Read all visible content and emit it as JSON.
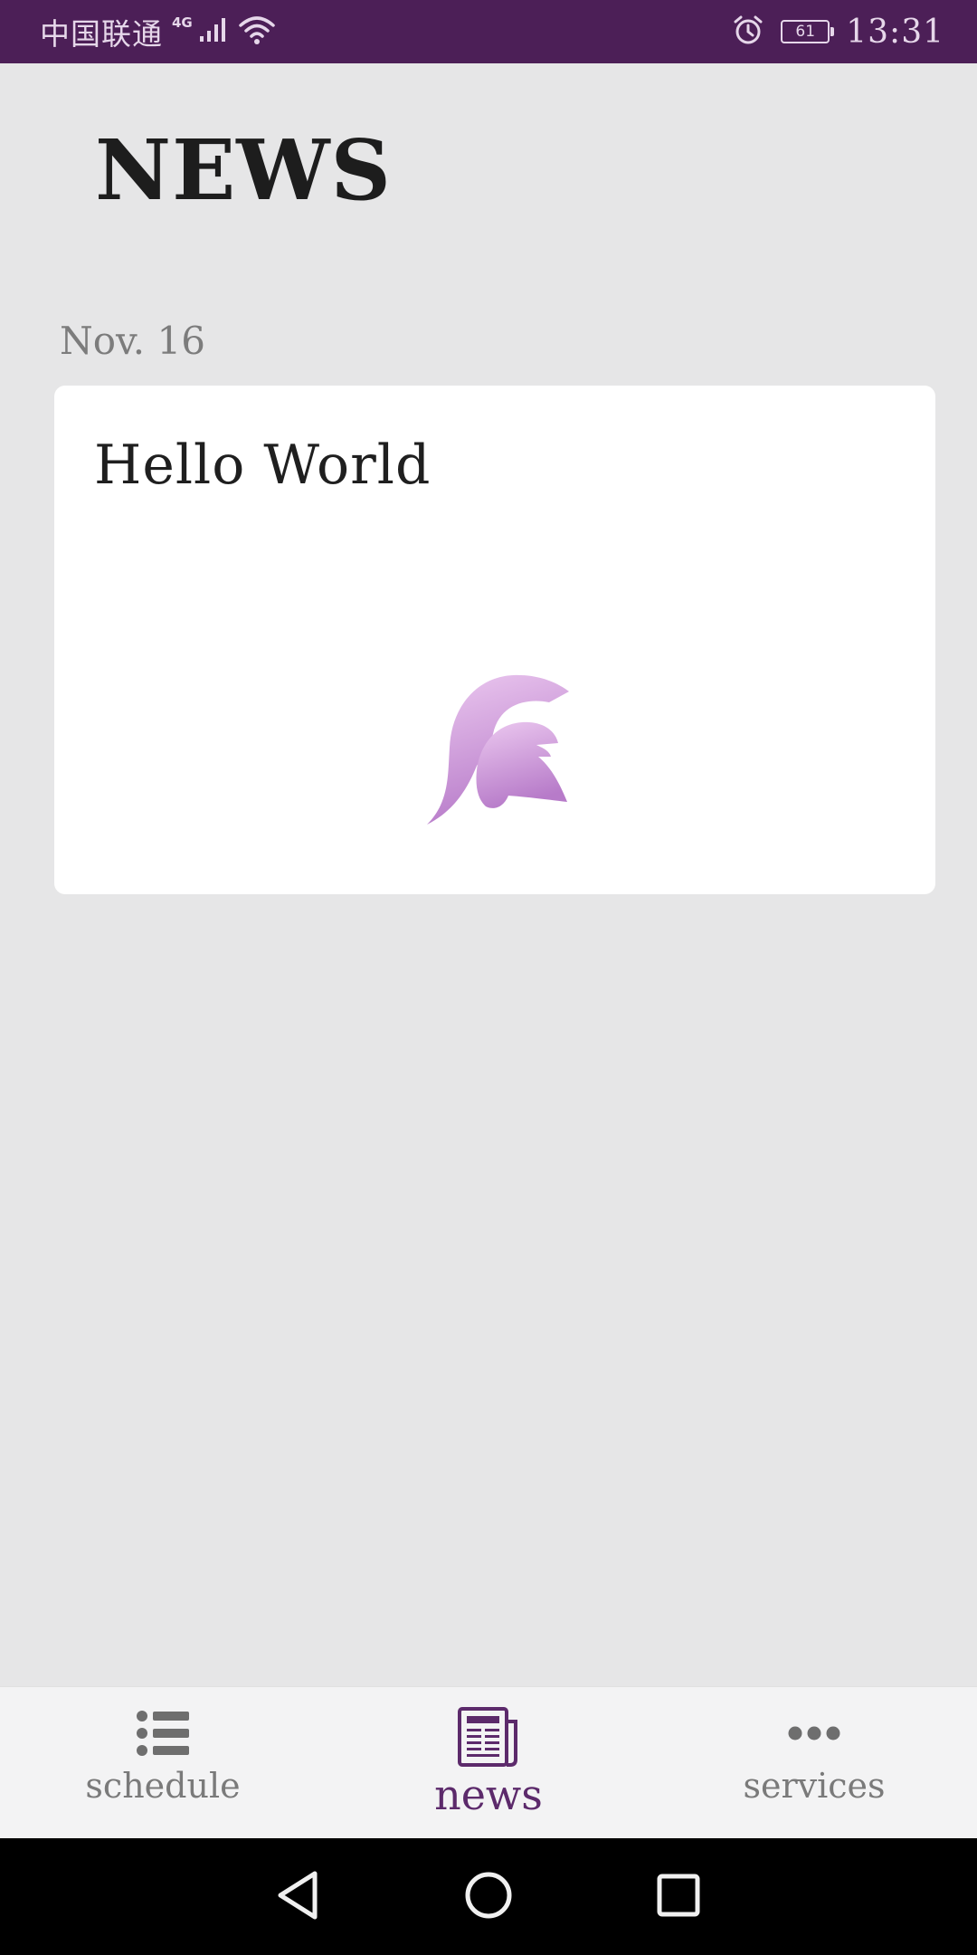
{
  "status_bar": {
    "carrier": "中国联通",
    "network_type": "4G",
    "battery_level": "61",
    "time": "13:31",
    "background_color": "#4c1f57",
    "icons": [
      "signal-icon",
      "wifi-icon",
      "alarm-icon",
      "battery-icon"
    ]
  },
  "page": {
    "title": "NEWS"
  },
  "news": {
    "date": "Nov. 16",
    "items": [
      {
        "title": "Hello World",
        "image_icon": "spartan-helmet-icon"
      }
    ]
  },
  "tab_bar": {
    "active": "news",
    "active_color": "#5c2a6b",
    "tabs": [
      {
        "label": "schedule",
        "icon": "list-icon"
      },
      {
        "label": "news",
        "icon": "newspaper-icon"
      },
      {
        "label": "services",
        "icon": "more-dots-icon"
      }
    ]
  },
  "nav_bar": {
    "buttons": [
      "back-icon",
      "home-icon",
      "recents-icon"
    ]
  }
}
